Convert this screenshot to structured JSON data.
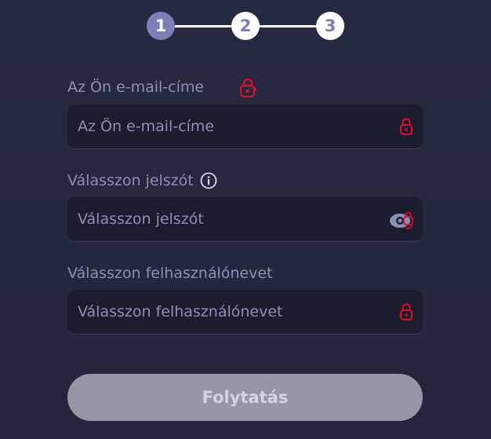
{
  "stepper": {
    "steps": [
      "1",
      "2",
      "3"
    ],
    "active_index": 0
  },
  "email": {
    "label": "Az Ön e-mail-címe",
    "placeholder": "Az Ön e-mail-címe",
    "value": "",
    "trailing_icon": "lock-icon"
  },
  "password": {
    "label": "Válasszon jelszót",
    "placeholder": "Válasszon jelszót",
    "value": "",
    "label_icon": "info-icon",
    "trailing_icon": "eye-icon"
  },
  "username": {
    "label": "Válasszon felhasználónevet",
    "placeholder": "Válasszon felhasználónevet",
    "value": "",
    "trailing_icon": "lock-icon"
  },
  "submit": {
    "label": "Folytatás"
  },
  "colors": {
    "background": "#252840",
    "step_active": "#7b80b8",
    "step_inactive": "#ffffff",
    "field_bg": "#1b1d2e",
    "label": "#8d90b8",
    "lock_red": "#e0102a",
    "button_disabled": "#9597a6"
  }
}
